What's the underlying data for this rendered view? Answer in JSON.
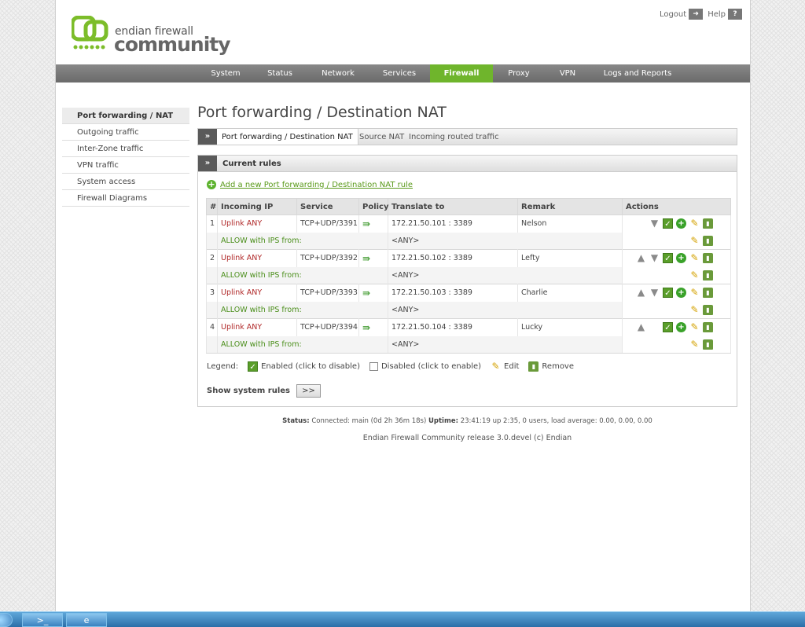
{
  "header": {
    "logo": {
      "line1": "endian firewall",
      "line2": "community"
    },
    "logout_label": "Logout",
    "help_label": "Help"
  },
  "nav": {
    "items": [
      {
        "label": "System"
      },
      {
        "label": "Status"
      },
      {
        "label": "Network"
      },
      {
        "label": "Services"
      },
      {
        "label": "Firewall",
        "active": true
      },
      {
        "label": "Proxy"
      },
      {
        "label": "VPN"
      },
      {
        "label": "Logs and Reports"
      }
    ]
  },
  "sidebar": {
    "items": [
      {
        "label": "Port forwarding / NAT",
        "active": true
      },
      {
        "label": "Outgoing traffic"
      },
      {
        "label": "Inter-Zone traffic"
      },
      {
        "label": "VPN traffic"
      },
      {
        "label": "System access"
      },
      {
        "label": "Firewall Diagrams"
      }
    ]
  },
  "page_title": "Port forwarding / Destination NAT",
  "tabs": [
    {
      "label": "Port forwarding / Destination NAT",
      "active": true
    },
    {
      "label": "Source NAT"
    },
    {
      "label": "Incoming routed traffic"
    }
  ],
  "chevron": "»",
  "panel": {
    "title": "Current rules",
    "add_link": "Add a new Port forwarding / Destination NAT rule",
    "columns": [
      "#",
      "Incoming IP",
      "Service",
      "Policy",
      "Translate to",
      "Remark",
      "Actions"
    ],
    "rules": [
      {
        "num": "1",
        "incoming": "Uplink ANY",
        "service": "TCP+UDP/3391",
        "translate": "172.21.50.101 : 3389",
        "remark": "Nelson",
        "allow": "ALLOW with IPS from:",
        "allow_to": "<ANY>"
      },
      {
        "num": "2",
        "incoming": "Uplink ANY",
        "service": "TCP+UDP/3392",
        "translate": "172.21.50.102 : 3389",
        "remark": "Lefty",
        "allow": "ALLOW with IPS from:",
        "allow_to": "<ANY>"
      },
      {
        "num": "3",
        "incoming": "Uplink ANY",
        "service": "TCP+UDP/3393",
        "translate": "172.21.50.103 : 3389",
        "remark": "Charlie",
        "allow": "ALLOW with IPS from:",
        "allow_to": "<ANY>"
      },
      {
        "num": "4",
        "incoming": "Uplink ANY",
        "service": "TCP+UDP/3394",
        "translate": "172.21.50.104 : 3389",
        "remark": "Lucky",
        "allow": "ALLOW with IPS from:",
        "allow_to": "<ANY>"
      }
    ],
    "legend": {
      "title": "Legend:",
      "enabled": "Enabled (click to disable)",
      "disabled": "Disabled (click to enable)",
      "edit": "Edit",
      "remove": "Remove"
    },
    "system_rules_label": "Show system rules",
    "system_rules_button": ">>"
  },
  "status": {
    "status_label": "Status:",
    "status_value": "Connected: main (0d 2h 36m 18s)",
    "uptime_label": "Uptime:",
    "uptime_value": "23:41:19 up 2:35, 0 users, load average: 0.00, 0.00, 0.00"
  },
  "footer": "Endian Firewall Community release 3.0.devel (c) Endian",
  "colors": {
    "accent": "#6fb52c",
    "nav_bg": "#777777",
    "red_text": "#b02828",
    "green_text": "#4a8e1a"
  }
}
